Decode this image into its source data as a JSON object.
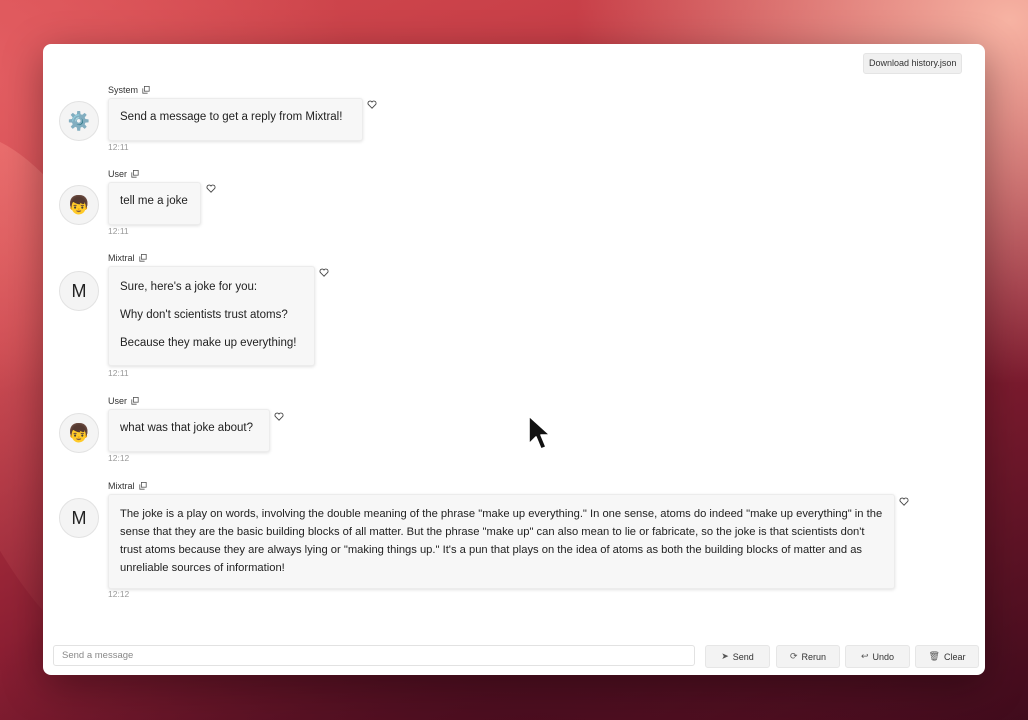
{
  "header": {
    "download_label": "Download history.json"
  },
  "messages": [
    {
      "sender": "System",
      "avatar": "⚙️",
      "paragraphs": [
        "Send a message to get a reply from Mixtral!"
      ],
      "time": "12:11"
    },
    {
      "sender": "User",
      "avatar": "👦",
      "paragraphs": [
        "tell me a joke"
      ],
      "time": "12:11"
    },
    {
      "sender": "Mixtral",
      "avatar": "M",
      "paragraphs": [
        "Sure, here's a joke for you:",
        "Why don't scientists trust atoms?",
        "Because they make up everything!"
      ],
      "time": "12:11"
    },
    {
      "sender": "User",
      "avatar": "👦",
      "paragraphs": [
        "what was that joke about?"
      ],
      "time": "12:12"
    },
    {
      "sender": "Mixtral",
      "avatar": "M",
      "paragraphs": [
        "The joke is a play on words, involving the double meaning of the phrase \"make up everything.\" In one sense, atoms do indeed \"make up everything\" in the sense that they are the basic building blocks of all matter. But the phrase \"make up\" can also mean to lie or fabricate, so the joke is that scientists don't trust atoms because they are always lying or \"making things up.\" It's a pun that plays on the idea of atoms as both the building blocks of matter and as unreliable sources of information!"
      ],
      "time": "12:12"
    }
  ],
  "footer": {
    "input_placeholder": "Send a message",
    "send_label": "Send",
    "rerun_label": "Rerun",
    "undo_label": "Undo",
    "clear_label": "Clear"
  }
}
